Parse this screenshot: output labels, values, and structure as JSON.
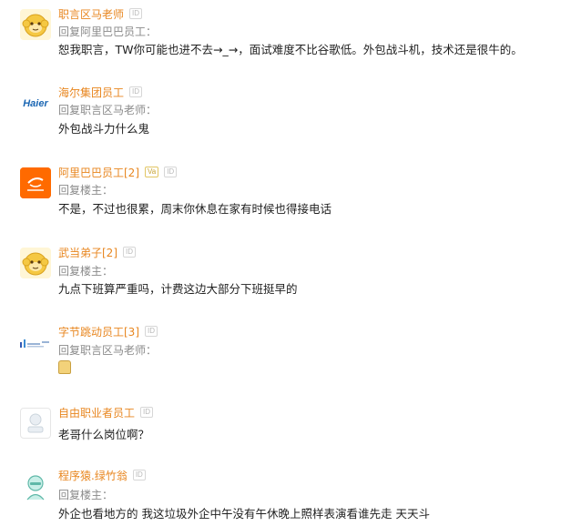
{
  "comments": [
    {
      "username": "职言区马老师",
      "badge": "ID",
      "reply_to": "回复阿里巴巴员工：",
      "content": "恕我职言，TW你可能也进不去→_→，面试难度不比谷歌低。外包战斗机，技术还是很牛的。",
      "avatar": "monkey-avatar"
    },
    {
      "username": "海尔集团员工",
      "badge": "ID",
      "avatar_text": "Haier",
      "reply_to": "回复职言区马老师：",
      "content": "外包战斗力什么鬼",
      "avatar": "haier-logo"
    },
    {
      "username": "阿里巴巴员工[2]",
      "vip_badge": "Va",
      "badge": "ID",
      "reply_to": "回复楼主：",
      "content": "不是，不过也很累，周末你休息在家有时候也得接电话",
      "avatar": "alibaba-logo"
    },
    {
      "username": "武当弟子[2]",
      "badge": "ID",
      "reply_to": "回复楼主：",
      "content": "九点下班算严重吗，计费这边大部分下班挺早的",
      "avatar": "monkey-avatar"
    },
    {
      "username": "字节跳动员工[3]",
      "badge": "ID",
      "reply_to": "回复职言区马老师：",
      "content": "",
      "content_emoji": "toast-emoji",
      "avatar": "bytedance-logo"
    },
    {
      "username": "自由职业者员工",
      "badge": "ID",
      "reply_to": "",
      "content": "老哥什么岗位啊？",
      "avatar": "freelancer-avatar"
    },
    {
      "username": "程序猿.绿竹翁",
      "badge": "ID",
      "reply_to": "回复楼主：",
      "content": "外企也看地方的 我这垃圾外企中午没有午休晚上照样表演看谁先走 天天斗",
      "avatar": "programmer-avatar"
    }
  ],
  "colors": {
    "username": "#e8861f",
    "reply": "#8a8a8a",
    "content": "#1f1f1f",
    "haier_blue": "#1a66b3",
    "alibaba_orange": "#ff6a00",
    "monkey_yellow": "#f5c842"
  }
}
